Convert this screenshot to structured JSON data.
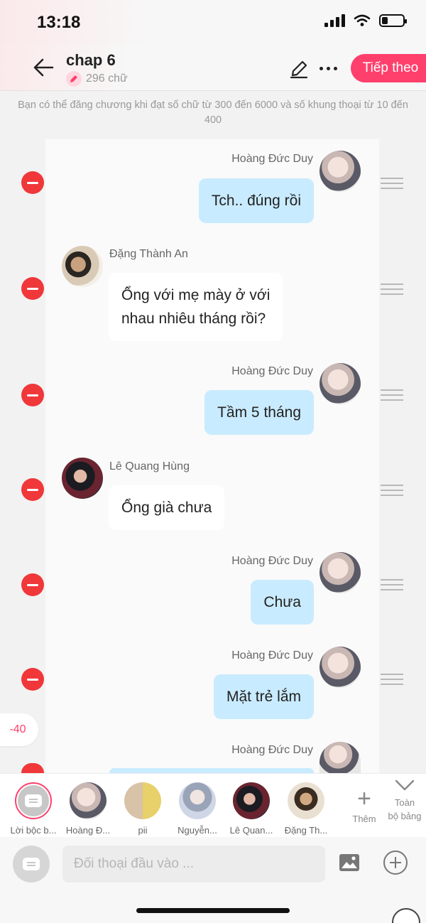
{
  "status": {
    "time": "13:18"
  },
  "header": {
    "title": "chap 6",
    "word_count": "296 chữ",
    "next_label": "Tiếp theo"
  },
  "notice": "Bạn có thể đăng chương khi đạt số chữ từ 300 đến 6000 và số khung thoại từ 10 đến 400",
  "messages": [
    {
      "side": "right",
      "sender": "Hoàng Đức Duy",
      "text": "Tch.. đúng rồi"
    },
    {
      "side": "left",
      "sender": "Đặng Thành An",
      "text": "Ổng với mẹ mày ở với\nnhau nhiêu tháng rồi?"
    },
    {
      "side": "right",
      "sender": "Hoàng Đức Duy",
      "text": "Tầm 5 tháng"
    },
    {
      "side": "left",
      "sender": "Lê Quang Hùng",
      "text": "Ổng già chưa"
    },
    {
      "side": "right",
      "sender": "Hoàng Đức Duy",
      "text": "Chưa"
    },
    {
      "side": "right",
      "sender": "Hoàng Đức Duy",
      "text": "Mặt trẻ lắm"
    },
    {
      "side": "right",
      "sender": "Hoàng Đức Duy",
      "text": ""
    }
  ],
  "offset_badge": "-40",
  "characters": [
    {
      "name": "Lời bộc b..."
    },
    {
      "name": "Hoàng Đ..."
    },
    {
      "name": "pii"
    },
    {
      "name": "Nguyễn..."
    },
    {
      "name": "Lê Quan..."
    },
    {
      "name": "Đặng Th..."
    }
  ],
  "add_label": "Thêm",
  "collapse_label": "Toàn\nbộ bảng",
  "input": {
    "placeholder": "Đối thoại đầu vào ..."
  }
}
